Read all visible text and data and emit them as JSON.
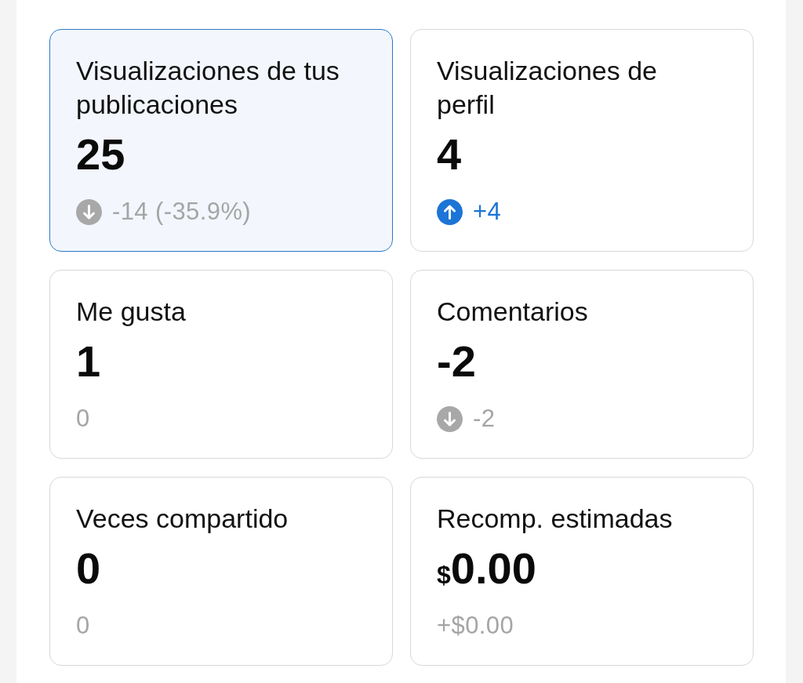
{
  "cards": [
    {
      "title": "Visualizaciones de tus publicaciones",
      "value": "25",
      "change": {
        "kind": "down",
        "text": "-14 (-35.9%)"
      },
      "selected": true
    },
    {
      "title": "Visualizaciones de perfil",
      "value": "4",
      "change": {
        "kind": "up",
        "text": "+4"
      },
      "selected": false
    },
    {
      "title": "Me gusta",
      "value": "1",
      "change": {
        "kind": "flat",
        "text": "0"
      },
      "selected": false
    },
    {
      "title": "Comentarios",
      "value": "-2",
      "change": {
        "kind": "down",
        "text": "-2"
      },
      "selected": false
    },
    {
      "title": "Veces compartido",
      "value": "0",
      "change": {
        "kind": "flat",
        "text": "0"
      },
      "selected": false
    },
    {
      "title": "Recomp. estimadas",
      "currency": "$",
      "value": "0.00",
      "change": {
        "kind": "flat",
        "text": "+$0.00"
      },
      "selected": false
    }
  ]
}
